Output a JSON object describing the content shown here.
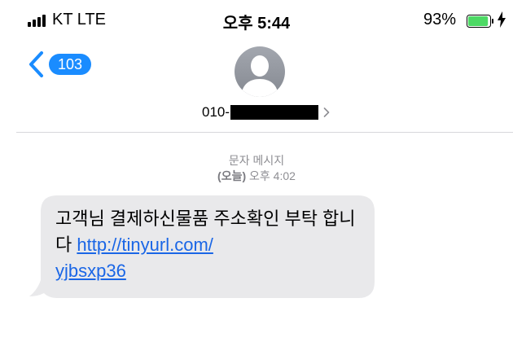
{
  "status_bar": {
    "carrier": "KT  LTE",
    "time": "오후 5:44",
    "battery_percent": "93%",
    "battery_level": 0.93,
    "battery_color": "#4cd964"
  },
  "header": {
    "back_count": "103",
    "contact_prefix": "010-",
    "accent_color": "#1a8cff"
  },
  "message_meta": {
    "label": "문자 메시지",
    "day": "(오늘)",
    "time": "오후 4:02"
  },
  "message": {
    "text": "고객님 결제하신물품 주소확인 부탁 합니다",
    "link_line1": "http://tinyurl.com/",
    "link_line2": "yjbsxp36",
    "bubble_color": "#e9e9eb",
    "link_color": "#1a66e6"
  }
}
